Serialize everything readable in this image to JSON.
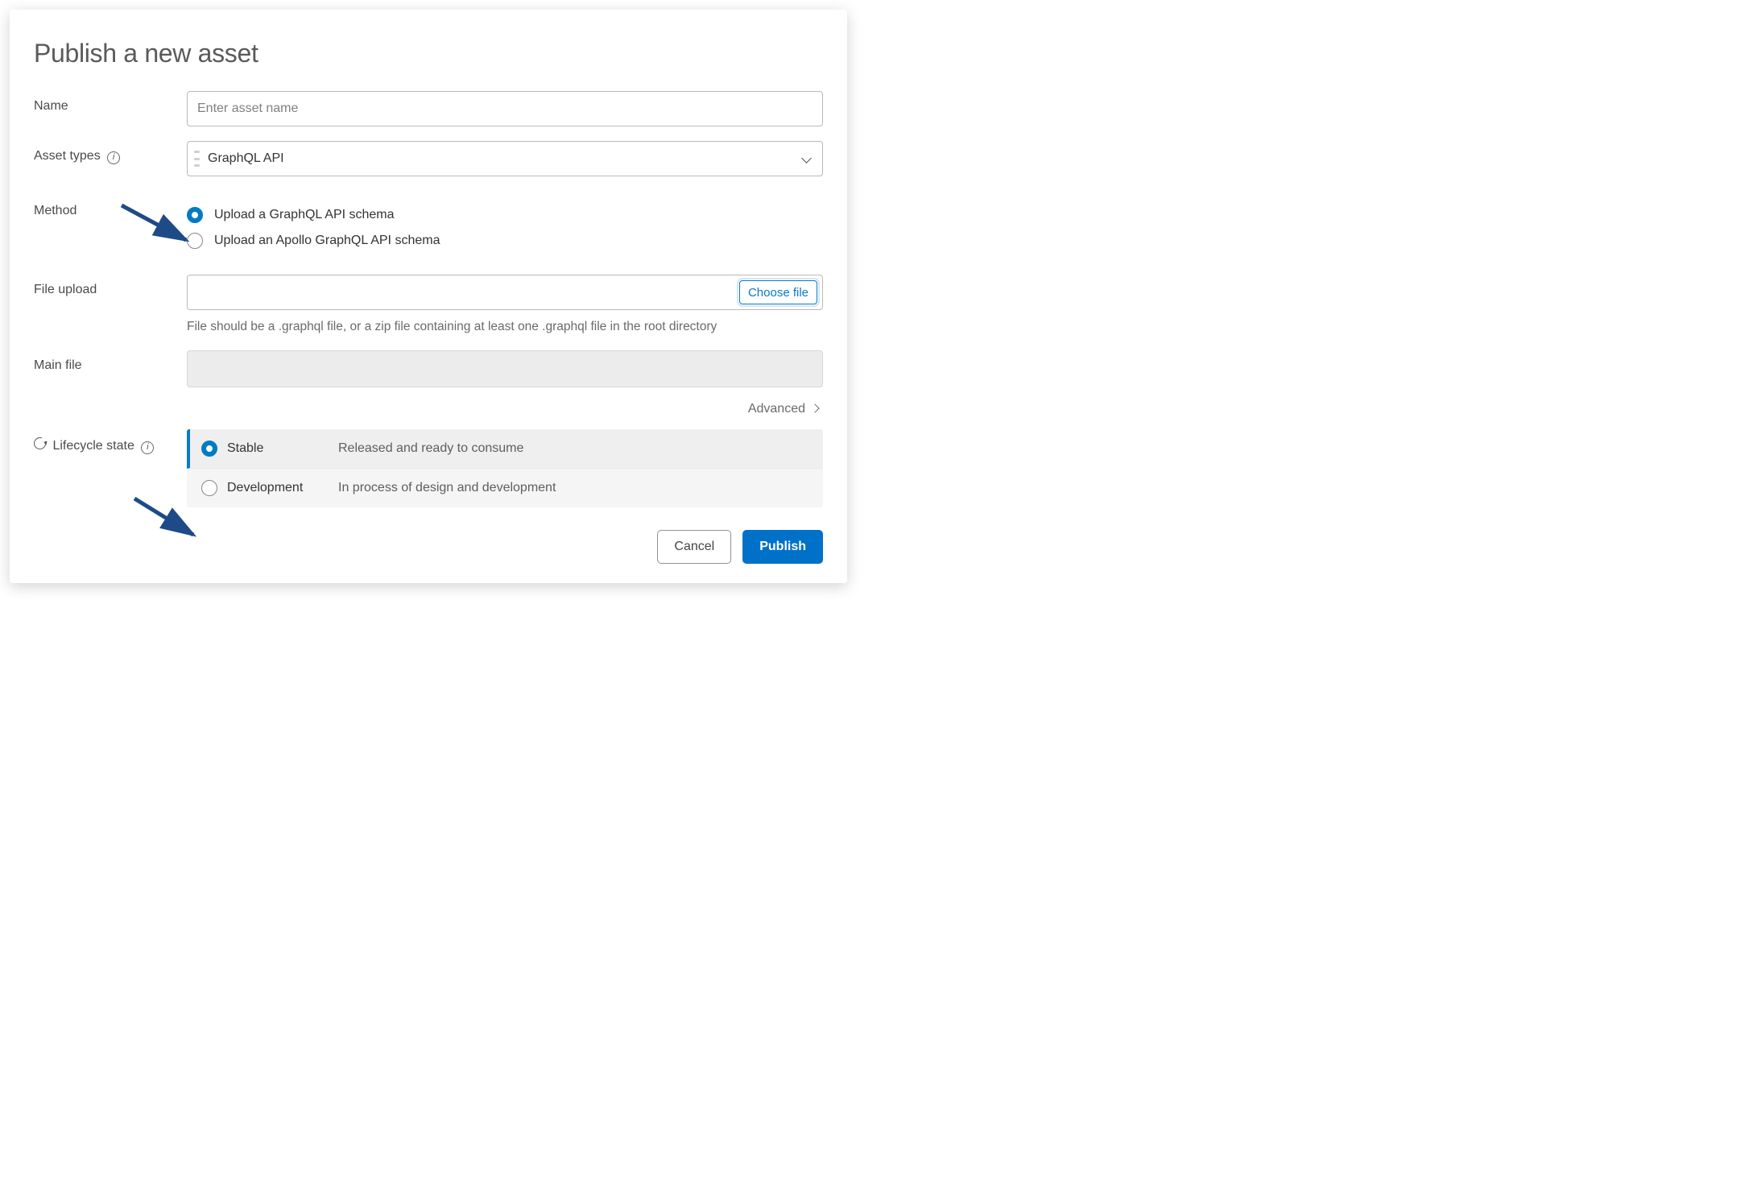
{
  "dialog": {
    "title": "Publish a new asset",
    "labels": {
      "name": "Name",
      "asset_types": "Asset types",
      "method": "Method",
      "file_upload": "File upload",
      "main_file": "Main file",
      "lifecycle": "Lifecycle state"
    },
    "name": {
      "placeholder": "Enter asset name",
      "value": ""
    },
    "asset_types": {
      "selected": "GraphQL API"
    },
    "method": {
      "options": [
        {
          "label": "Upload a GraphQL API schema",
          "selected": true
        },
        {
          "label": "Upload an Apollo GraphQL API schema",
          "selected": false
        }
      ]
    },
    "file_upload": {
      "choose_button": "Choose file",
      "helper": "File should be a .graphql file, or a zip file containing at least one .graphql file in the root directory"
    },
    "advanced_label": "Advanced",
    "lifecycle": {
      "options": [
        {
          "name": "Stable",
          "description": "Released and ready to consume",
          "selected": true
        },
        {
          "name": "Development",
          "description": "In process of design and development",
          "selected": false
        }
      ]
    },
    "actions": {
      "cancel": "Cancel",
      "publish": "Publish"
    }
  }
}
